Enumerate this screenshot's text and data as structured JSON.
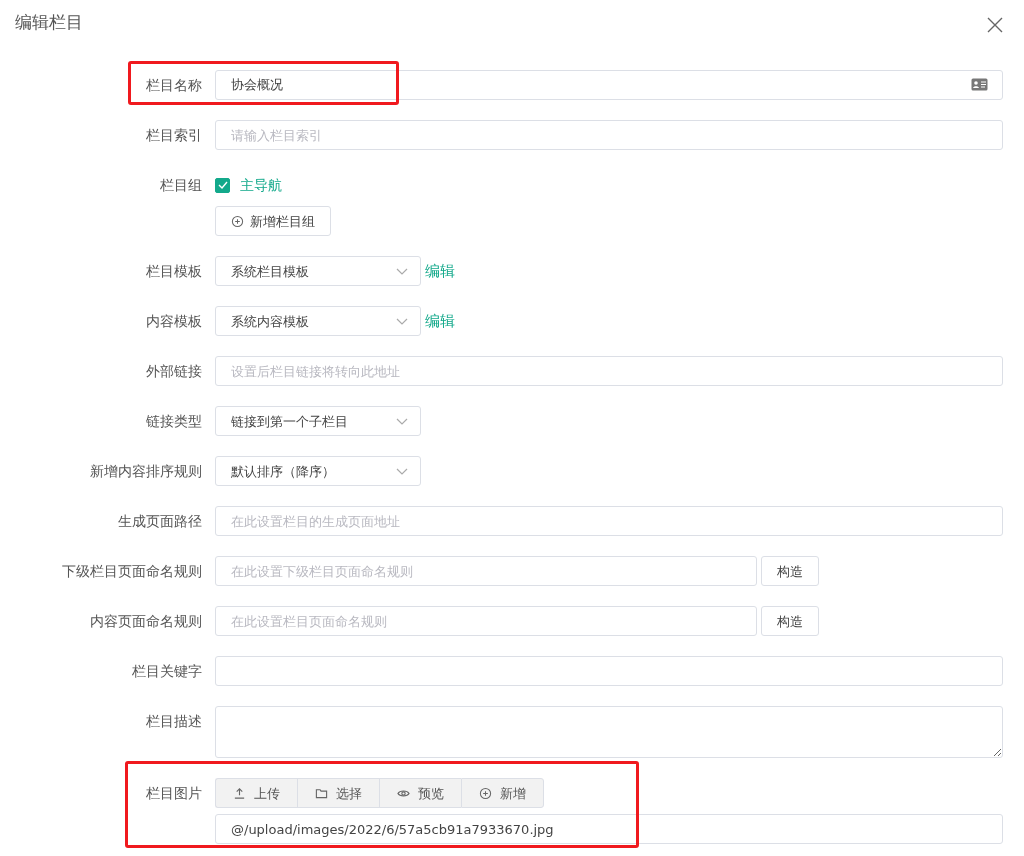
{
  "dialog": {
    "title": "编辑栏目"
  },
  "fields": [
    {
      "kind": "cardtext",
      "label": "栏目名称",
      "value": "协会概况",
      "highlighted": true
    },
    {
      "kind": "text",
      "label": "栏目索引",
      "placeholder": "请输入栏目索引"
    },
    {
      "kind": "checkgroup",
      "label": "栏目组",
      "options": [
        {
          "label": "主导航",
          "checked": true
        }
      ],
      "button": "新增栏目组"
    },
    {
      "kind": "select",
      "label": "栏目模板",
      "value": "系统栏目模板",
      "link": "编辑"
    },
    {
      "kind": "select",
      "label": "内容模板",
      "value": "系统内容模板",
      "link": "编辑"
    },
    {
      "kind": "text",
      "label": "外部链接",
      "placeholder": "设置后栏目链接将转向此地址"
    },
    {
      "kind": "select",
      "label": "链接类型",
      "value": "链接到第一个子栏目"
    },
    {
      "kind": "select",
      "label": "新增内容排序规则",
      "value": "默认排序（降序）"
    },
    {
      "kind": "text",
      "label": "生成页面路径",
      "placeholder": "在此设置栏目的生成页面地址"
    },
    {
      "kind": "text",
      "label": "下级栏目页面命名规则",
      "placeholder": "在此设置下级栏目页面命名规则",
      "button": "构造"
    },
    {
      "kind": "text",
      "label": "内容页面命名规则",
      "placeholder": "在此设置栏目页面命名规则",
      "button": "构造"
    },
    {
      "kind": "text",
      "label": "栏目关键字"
    },
    {
      "kind": "textarea",
      "label": "栏目描述"
    },
    {
      "kind": "upload",
      "label": "栏目图片",
      "actions": [
        {
          "label": "上传"
        },
        {
          "label": "选择"
        },
        {
          "label": "预览"
        },
        {
          "label": "新增"
        }
      ],
      "value": "@/upload/images/2022/6/57a5cb91a7933670.jpg",
      "highlighted": true
    }
  ]
}
